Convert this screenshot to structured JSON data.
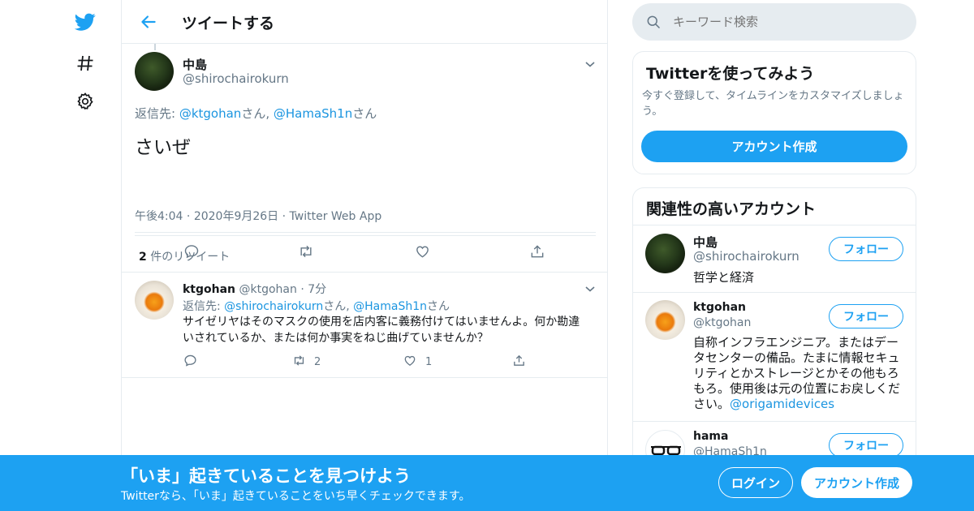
{
  "nav": {
    "icons": [
      "twitter-logo-icon",
      "hashtag-icon",
      "settings-gear-icon"
    ]
  },
  "header": {
    "title": "ツイートする"
  },
  "focused_tweet": {
    "name": "中島",
    "handle": "@shirochairokurn",
    "reply_prefix": "返信先: ",
    "reply_to_1": "@ktgohan",
    "reply_suffix_1": "さん, ",
    "reply_to_2": "@HamaSh1n",
    "reply_suffix_2": "さん",
    "text": "さいぜ",
    "time": "午後4:04",
    "date": "2020年9月26日",
    "source": "Twitter Web App",
    "sep": "·",
    "retweet_count": "2",
    "retweet_label": " 件のリツイート"
  },
  "reply_tweet": {
    "name": "ktgohan",
    "handle": "@ktgohan",
    "sep": "·",
    "age": "7分",
    "reply_prefix": "返信先: ",
    "reply_to_1": "@shirochairokurn",
    "reply_suffix_1": "さん, ",
    "reply_to_2": "@HamaSh1n",
    "reply_suffix_2": "さん",
    "text": "サイゼリヤはそのマスクの使用を店内客に義務付けてはいませんよ。何か勘違いされているか、または何か事実をねじ曲げていませんか？",
    "retweets": "2",
    "likes": "1"
  },
  "search": {
    "placeholder": "キーワード検索"
  },
  "signup_card": {
    "title": "Twitterを使ってみよう",
    "desc": "今すぐ登録して、タイムラインをカスタマイズしましょう。",
    "button": "アカウント作成"
  },
  "related": {
    "title": "関連性の高いアカウント",
    "follow_label": "フォロー",
    "accounts": [
      {
        "name": "中島",
        "handle": "@shirochairokurn",
        "bio": "哲学と経済",
        "bio_link": ""
      },
      {
        "name": "ktgohan",
        "handle": "@ktgohan",
        "bio": "自称インフラエンジニア。またはデータセンターの備品。たまに情報セキュリティとかストレージとかその他もろもろ。使用後は元の位置にお戻しください。",
        "bio_link": "@origamidevices"
      },
      {
        "name": "hama",
        "handle": "@HamaSh1n",
        "bio": "",
        "bio_link": ""
      }
    ]
  },
  "bottom_bar": {
    "headline": "「いま」起きていることを見つけよう",
    "sub": "Twitterなら、「いま」起きていることをいち早くチェックできます。",
    "login": "ログイン",
    "signup": "アカウント作成"
  },
  "colors": {
    "accent": "#1da1f2",
    "link": "#1b95e0",
    "muted": "#657786",
    "border": "#e6ecf0"
  }
}
